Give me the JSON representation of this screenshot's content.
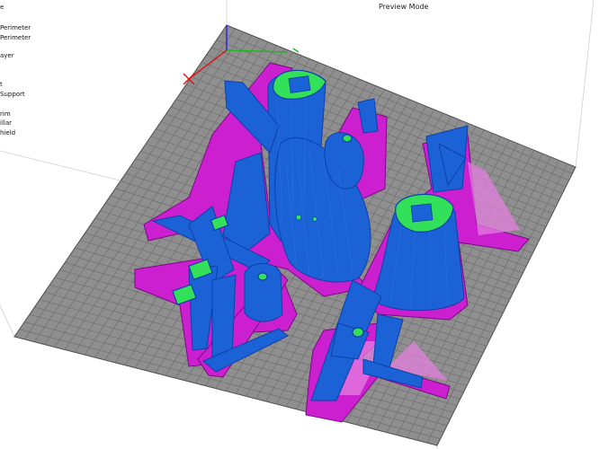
{
  "view": {
    "mode_label": "Preview Mode"
  },
  "legend": {
    "items": [
      {
        "label": "e"
      },
      {
        "label": "Perimeter"
      },
      {
        "label": "Perimeter"
      },
      {
        "label": "ayer"
      },
      {
        "label": "t"
      },
      {
        "label": "Support"
      },
      {
        "label": "rim"
      },
      {
        "label": "illar"
      },
      {
        "label": "hield"
      }
    ]
  },
  "colors": {
    "background": "#ffffff",
    "bed": "#8f8f8f",
    "bed_grid": "#6f6f6f",
    "perimeter_blue": "#1a62d6",
    "perimeter_blue_dark": "#0f3fa8",
    "skirt_magenta": "#cc1fd0",
    "infill_green": "#33e05a",
    "axis_red": "#e01010",
    "axis_green": "#1bb81b",
    "axis_blue": "#2424d0"
  }
}
